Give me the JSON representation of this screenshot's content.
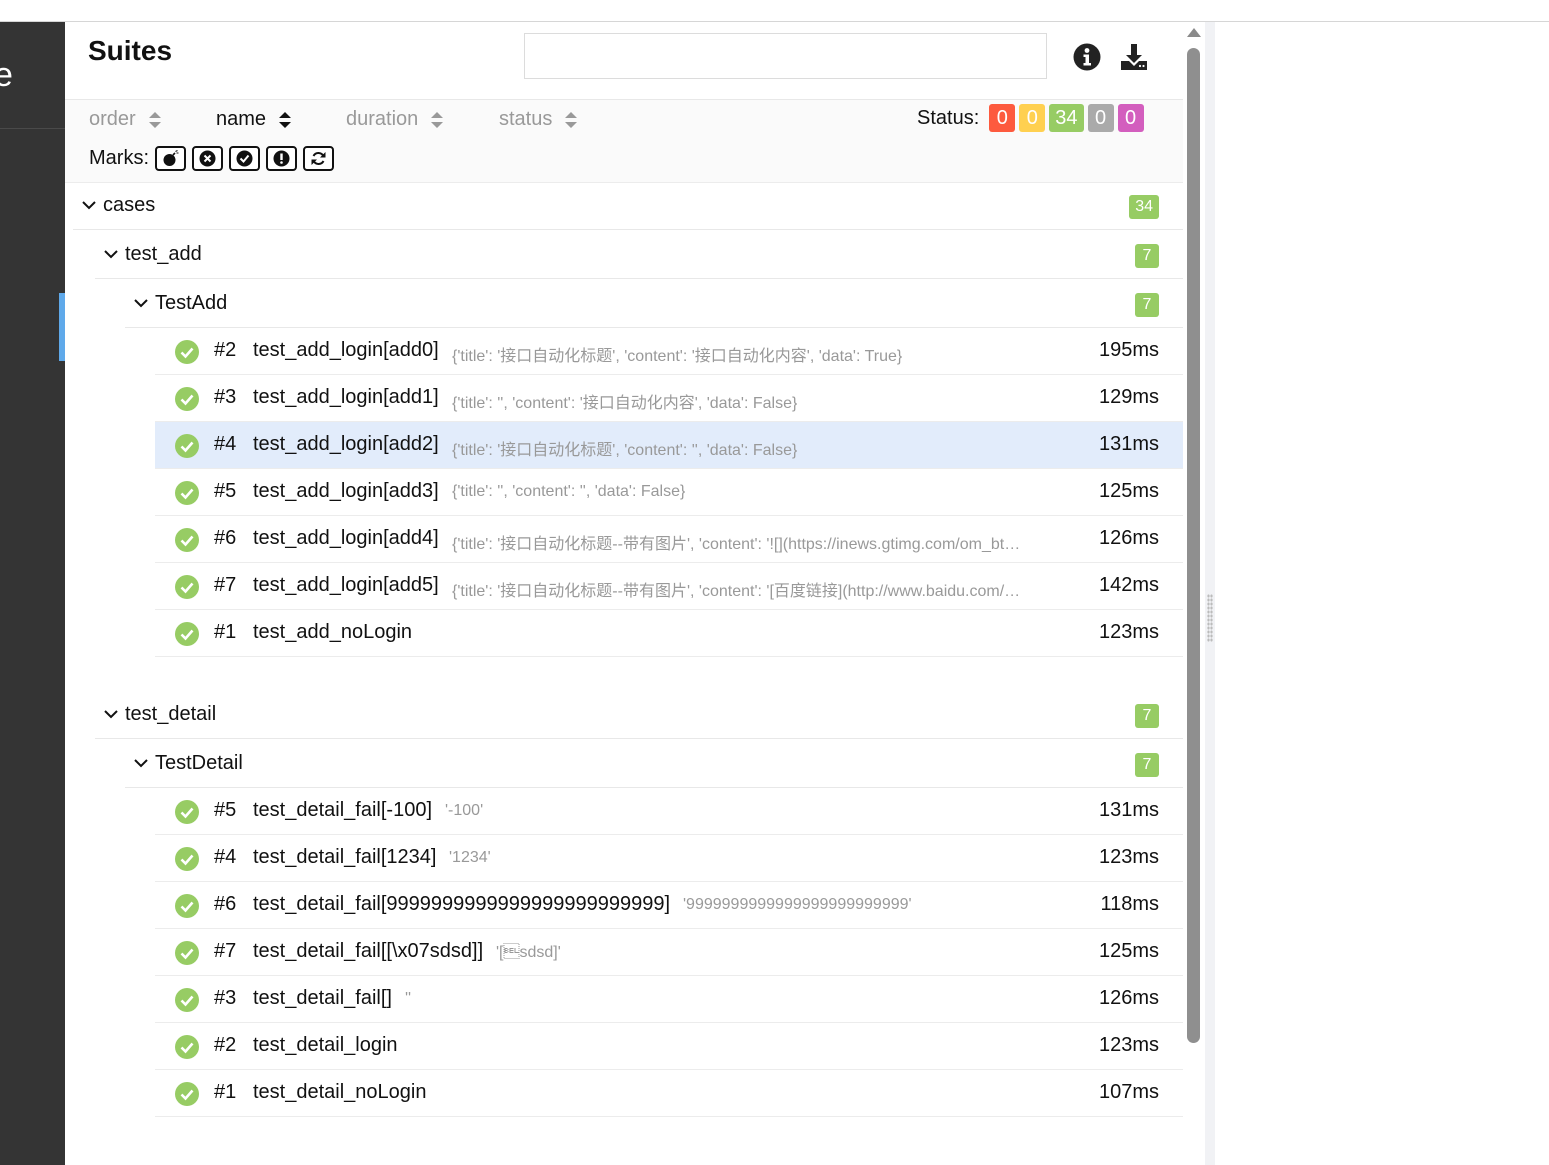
{
  "sidebar": {
    "logo_fragment": "e"
  },
  "header": {
    "title": "Suites",
    "search": {
      "value": "",
      "placeholder": ""
    }
  },
  "icons": {
    "info": "info-circle-icon",
    "download": "download-icon"
  },
  "sorters": [
    {
      "label": "order",
      "active": false
    },
    {
      "label": "name",
      "active": true
    },
    {
      "label": "duration",
      "active": false
    },
    {
      "label": "status",
      "active": false
    }
  ],
  "status": {
    "label": "Status:",
    "badges": [
      {
        "value": "0",
        "color": "#fd5a3e",
        "meaning": "failed"
      },
      {
        "value": "0",
        "color": "#ffd050",
        "meaning": "broken"
      },
      {
        "value": "34",
        "color": "#97cc64",
        "meaning": "passed"
      },
      {
        "value": "0",
        "color": "#aaaaaa",
        "meaning": "skipped"
      },
      {
        "value": "0",
        "color": "#d35ebe",
        "meaning": "unknown"
      }
    ]
  },
  "marks": {
    "label": "Marks:",
    "items": [
      "bomb-icon",
      "times-circle-icon",
      "check-circle-icon",
      "exclamation-circle-icon",
      "refresh-icon"
    ]
  },
  "tree": {
    "root": {
      "name": "cases",
      "count": "34"
    },
    "groups": [
      {
        "module": "test_add",
        "module_count": "7",
        "class": "TestAdd",
        "class_count": "7",
        "cases": [
          {
            "num": "#2",
            "name": "test_add_login[add0]",
            "params": "{'title': '接口自动化标题', 'content': '接口自动化内容', 'data': True}",
            "duration": "195ms"
          },
          {
            "num": "#3",
            "name": "test_add_login[add1]",
            "params": "{'title': '', 'content': '接口自动化内容', 'data': False}",
            "duration": "129ms"
          },
          {
            "num": "#4",
            "name": "test_add_login[add2]",
            "params": "{'title': '接口自动化标题', 'content': '', 'data': False}",
            "duration": "131ms",
            "selected": true
          },
          {
            "num": "#5",
            "name": "test_add_login[add3]",
            "params": "{'title': '', 'content': '', 'data': False}",
            "duration": "125ms"
          },
          {
            "num": "#6",
            "name": "test_add_login[add4]",
            "params": "{'title': '接口自动化标题--带有图片', 'content': '![](https://inews.gtimg.com/om_bt…",
            "duration": "126ms"
          },
          {
            "num": "#7",
            "name": "test_add_login[add5]",
            "params": "{'title': '接口自动化标题--带有图片', 'content': '[百度链接](http://www.baidu.com/…",
            "duration": "142ms"
          },
          {
            "num": "#1",
            "name": "test_add_noLogin",
            "params": "",
            "duration": "123ms"
          }
        ]
      },
      {
        "module": "test_detail",
        "module_count": "7",
        "class": "TestDetail",
        "class_count": "7",
        "cases": [
          {
            "num": "#5",
            "name": "test_detail_fail[-100]",
            "params": "'-100'",
            "duration": "131ms"
          },
          {
            "num": "#4",
            "name": "test_detail_fail[1234]",
            "params": "'1234'",
            "duration": "123ms"
          },
          {
            "num": "#6",
            "name": "test_detail_fail[9999999999999999999999999]",
            "params": "'9999999999999999999999999'",
            "duration": "118ms"
          },
          {
            "num": "#7",
            "name": "test_detail_fail[[\\x07sdsd]]",
            "params": "'[\u0007sdsd]'",
            "duration": "125ms"
          },
          {
            "num": "#3",
            "name": "test_detail_fail[]",
            "params": "''",
            "duration": "126ms"
          },
          {
            "num": "#2",
            "name": "test_detail_login",
            "params": "",
            "duration": "123ms"
          },
          {
            "num": "#1",
            "name": "test_detail_noLogin",
            "params": "",
            "duration": "107ms"
          }
        ]
      }
    ]
  }
}
